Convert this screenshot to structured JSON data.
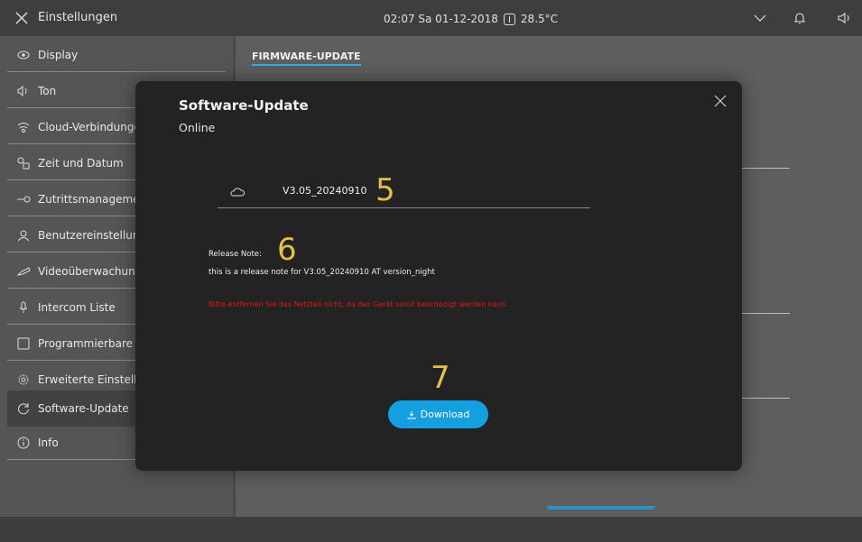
{
  "topbar": {
    "title": "Einstellungen",
    "datetime": "02:07 Sa 01-12-2018",
    "temperature": "28.5°C",
    "icons": [
      "close-icon",
      "thermometer-icon",
      "chevron-down-icon",
      "bell-icon",
      "speaker-icon"
    ]
  },
  "sidebar": {
    "items": [
      {
        "label": "Display",
        "icon": "eye-icon"
      },
      {
        "label": "Ton",
        "icon": "speaker-icon"
      },
      {
        "label": "Cloud-Verbindungen",
        "icon": "wifi-icon"
      },
      {
        "label": "Zeit und Datum",
        "icon": "clock-calendar-icon"
      },
      {
        "label": "Zutrittsmanagement",
        "icon": "key-icon"
      },
      {
        "label": "Benutzereinstellungen",
        "icon": "user-icon"
      },
      {
        "label": "Videoüberwachung",
        "icon": "camera-icon"
      },
      {
        "label": "Intercom Liste",
        "icon": "microphone-icon"
      },
      {
        "label": "Programmierbare Tasten",
        "icon": "square-icon"
      },
      {
        "label": "Erweiterte Einstellungen",
        "icon": "gear-icon"
      },
      {
        "label": "Software-Update",
        "icon": "refresh-icon"
      },
      {
        "label": "Info",
        "icon": "info-icon"
      }
    ],
    "active_index": 10
  },
  "content": {
    "tab_label": "FIRMWARE-UPDATE"
  },
  "modal": {
    "title": "Software-Update",
    "subtitle": "Online",
    "version": "V3.05_20240910",
    "release_note_label": "Release Note:",
    "release_note_text": "this is a release note for V3.05_20240910 AT version_night",
    "warning": "Bitte entfernen Sie das Netzteil nicht, da das Gerät sonst beschädigt werden kann.",
    "download_label": "Download",
    "annotations": {
      "a5": "5",
      "a6": "6",
      "a7": "7"
    }
  },
  "colors": {
    "accent": "#14a0e0",
    "warning": "#e2161d",
    "annotation": "#e2c04a"
  }
}
